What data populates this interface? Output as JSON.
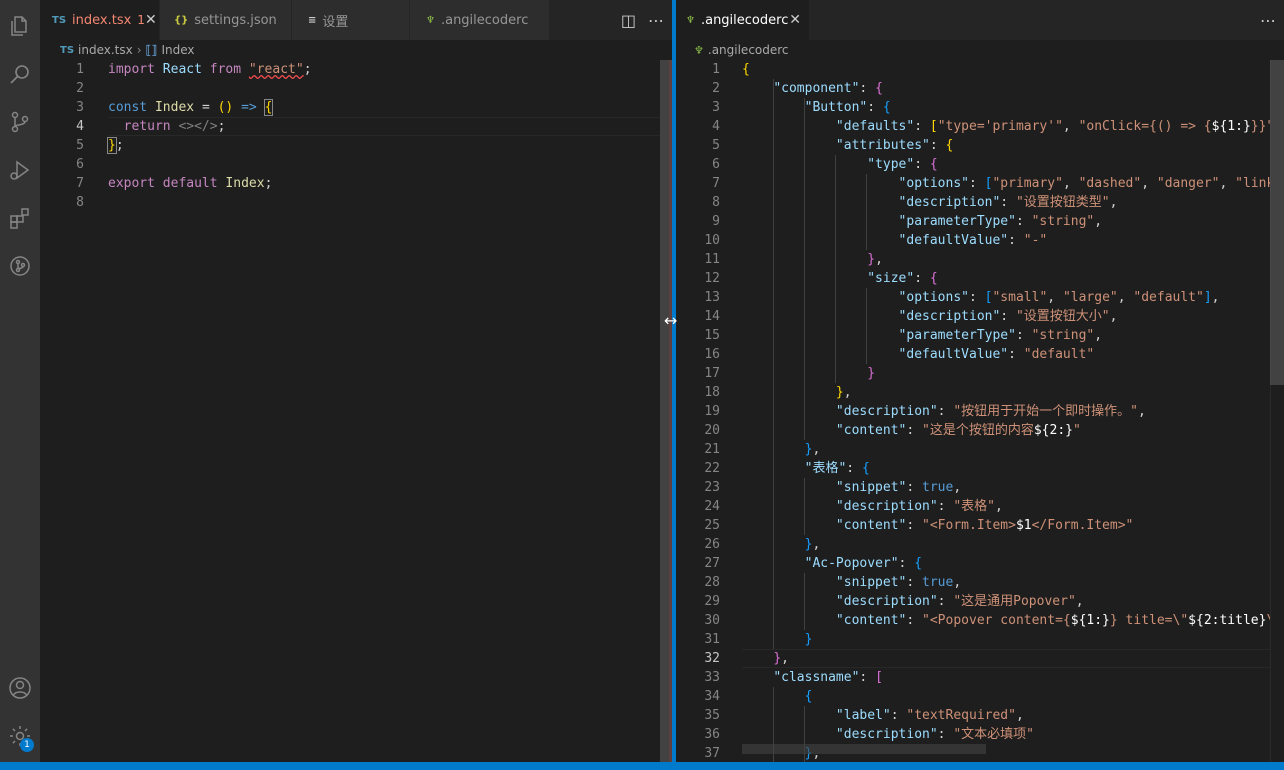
{
  "left_editor": {
    "tabs": [
      {
        "icon": "TS",
        "label": "index.tsx",
        "badge": "1",
        "active": true
      },
      {
        "icon": "{}",
        "label": "settings.json",
        "active": false
      },
      {
        "icon": "≡",
        "label": "设置",
        "active": false
      },
      {
        "icon": "angilecoder-icon",
        "label": ".angilecoderc",
        "active": false
      }
    ],
    "breadcrumb": {
      "file": "index.tsx",
      "symbol": "Index"
    },
    "line_numbers": [
      "1",
      "2",
      "3",
      "4",
      "5",
      "6",
      "7",
      "8"
    ],
    "cursor_line": "4"
  },
  "right_editor": {
    "tab": {
      "label": ".angilecoderc"
    },
    "breadcrumb": {
      "file": ".angilecoderc"
    },
    "cursor_line": "32",
    "line_numbers": [
      "1",
      "2",
      "3",
      "4",
      "5",
      "6",
      "7",
      "8",
      "9",
      "10",
      "11",
      "12",
      "13",
      "14",
      "15",
      "16",
      "17",
      "18",
      "19",
      "20",
      "21",
      "22",
      "23",
      "24",
      "25",
      "26",
      "27",
      "28",
      "29",
      "30",
      "31",
      "32",
      "33",
      "34",
      "35",
      "36",
      "37"
    ]
  },
  "activity_bar": {
    "icons": [
      "explorer-icon",
      "search-icon",
      "source-control-icon",
      "run-debug-icon",
      "extensions-icon",
      "git-graph-icon"
    ],
    "bottom_icons": [
      "accounts-icon",
      "manage-gear-icon"
    ],
    "manage_badge": "1"
  },
  "colors": {
    "accent": "#007acc",
    "editor_bg": "#1e1e1e",
    "activity_bg": "#333333"
  }
}
